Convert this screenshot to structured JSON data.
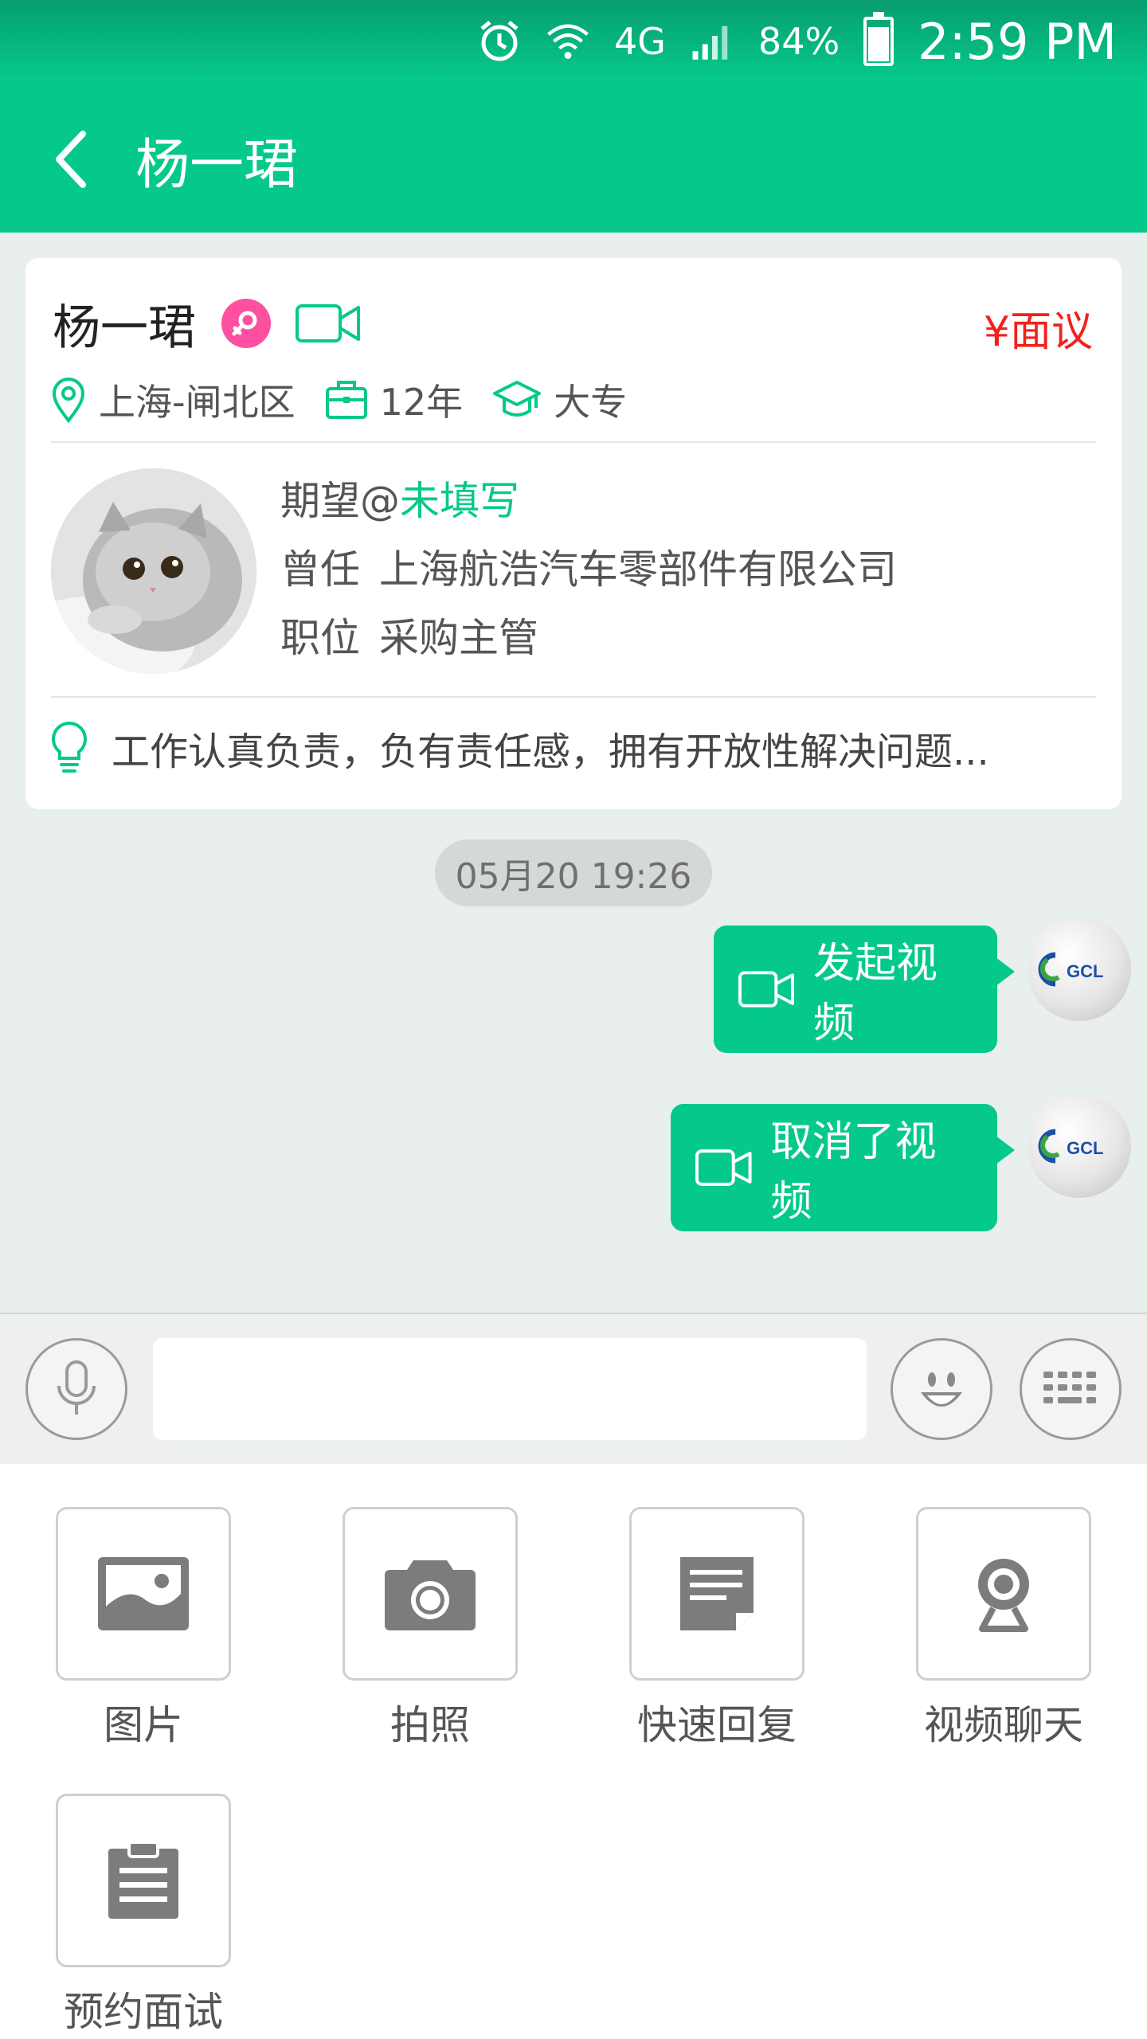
{
  "status_bar": {
    "network": "4G",
    "battery": "84%",
    "time": "2:59 PM"
  },
  "header": {
    "title": "杨一珺"
  },
  "profile": {
    "name": "杨一珺",
    "salary": "¥面议",
    "location": "上海-闸北区",
    "experience": "12年",
    "education": "大专",
    "expect_prefix": "期望@",
    "expect_value": "未填写",
    "former_label": "曾任",
    "former_company": "上海航浩汽车零部件有限公司",
    "position_label": "职位",
    "position": "采购主管",
    "summary": "工作认真负责，负有责任感，拥有开放性解决问题..."
  },
  "chat": {
    "timestamp": "05月20 19:26",
    "messages": [
      {
        "text": "发起视频"
      },
      {
        "text": "取消了视频"
      }
    ],
    "avatar_text": "GCL"
  },
  "input": {
    "placeholder": ""
  },
  "tools": [
    {
      "label": "图片",
      "icon": "image-icon"
    },
    {
      "label": "拍照",
      "icon": "camera-icon"
    },
    {
      "label": "快速回复",
      "icon": "quick-reply-icon"
    },
    {
      "label": "视频聊天",
      "icon": "webcam-icon"
    },
    {
      "label": "预约面试",
      "icon": "clipboard-icon"
    }
  ],
  "colors": {
    "accent": "#05c98a",
    "salary": "#f3201b",
    "female_badge": "#ff4fa0"
  }
}
